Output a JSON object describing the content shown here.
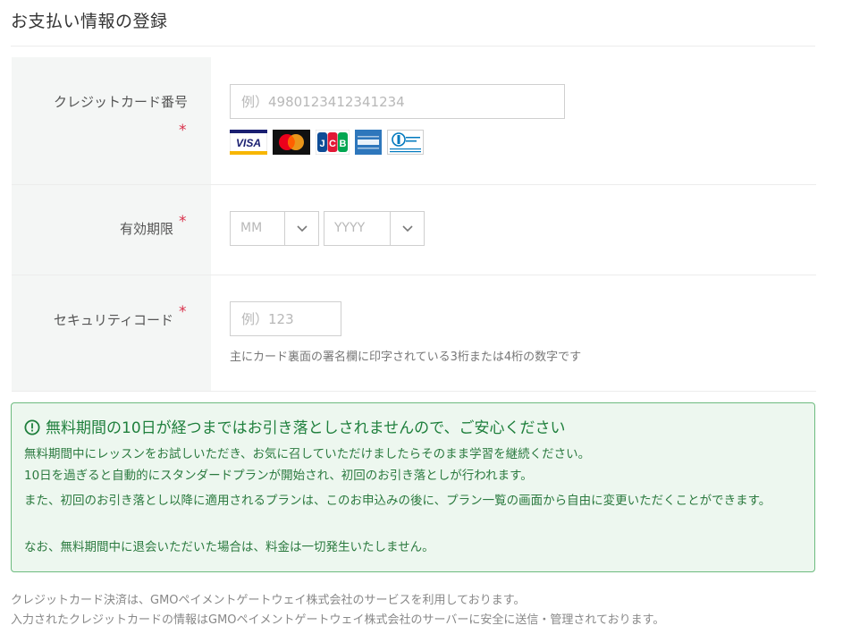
{
  "page": {
    "title": "お支払い情報の登録"
  },
  "form": {
    "card_number": {
      "label": "クレジットカード番号",
      "required_mark": "*",
      "placeholder": "例）4980123412341234",
      "brands": [
        "VISA",
        "Mastercard",
        "JCB",
        "AMERICAN EXPRESS",
        "Diners Club INTERNATIONAL"
      ]
    },
    "expiry": {
      "label": "有効期限",
      "required_mark": "*",
      "month_placeholder": "MM",
      "year_placeholder": "YYYY"
    },
    "security_code": {
      "label": "セキュリティコード",
      "required_mark": "*",
      "placeholder": "例）123",
      "hint": "主にカード裏面の署名欄に印字されている3桁または4桁の数字です"
    }
  },
  "notice": {
    "heading": "無料期間の10日が経つまではお引き落としされませんので、ご安心ください",
    "lines": [
      "無料期間中にレッスンをお試しいただき、お気に召していただけましたらそのまま学習を継続ください。",
      "10日を過ぎると自動的にスタンダードプランが開始され、初回のお引き落としが行われます。",
      "また、初回のお引き落とし以降に適用されるプランは、このお申込みの後に、プラン一覧の画面から自由に変更いただくことができます。",
      "なお、無料期間中に退会いただいた場合は、料金は一切発生いたしません。"
    ]
  },
  "footer": {
    "line1": "クレジットカード決済は、GMOペイメントゲートウェイ株式会社のサービスを利用しております。",
    "line2": "入力されたクレジットカードの情報はGMOペイメントゲートウェイ株式会社のサーバーに安全に送信・管理されております。"
  },
  "colors": {
    "required": "#d9304a",
    "notice_border": "#6dbb7f",
    "notice_bg": "#edf7ef",
    "notice_text": "#1e7f3c",
    "label_bg": "#f4f6f5"
  }
}
